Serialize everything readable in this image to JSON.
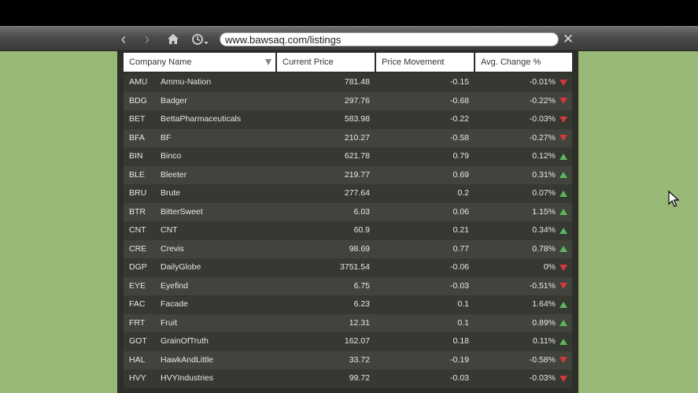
{
  "browser": {
    "url": "www.bawsaq.com/listings",
    "icons": {
      "back": "arrow-left-icon",
      "forward": "arrow-right-icon",
      "home": "home-icon",
      "history": "clock-icon",
      "close": "close-icon"
    }
  },
  "table": {
    "headers": [
      "Company Name",
      "Current Price",
      "Price Movement",
      "Avg. Change %"
    ],
    "rows": [
      {
        "symbol": "AMU",
        "name": "Ammu-Nation",
        "price": "781.48",
        "movement": "-0.15",
        "avg": "-0.01%",
        "trend": "down"
      },
      {
        "symbol": "BDG",
        "name": "Badger",
        "price": "297.76",
        "movement": "-0.68",
        "avg": "-0.22%",
        "trend": "down"
      },
      {
        "symbol": "BET",
        "name": "BettaPharmaceuticals",
        "price": "583.98",
        "movement": "-0.22",
        "avg": "-0.03%",
        "trend": "down"
      },
      {
        "symbol": "BFA",
        "name": "BF",
        "price": "210.27",
        "movement": "-0.58",
        "avg": "-0.27%",
        "trend": "down"
      },
      {
        "symbol": "BIN",
        "name": "Binco",
        "price": "621.78",
        "movement": "0.79",
        "avg": "0.12%",
        "trend": "up"
      },
      {
        "symbol": "BLE",
        "name": "Bleeter",
        "price": "219.77",
        "movement": "0.69",
        "avg": "0.31%",
        "trend": "up"
      },
      {
        "symbol": "BRU",
        "name": "Brute",
        "price": "277.64",
        "movement": "0.2",
        "avg": "0.07%",
        "trend": "up"
      },
      {
        "symbol": "BTR",
        "name": "BitterSweet",
        "price": "6.03",
        "movement": "0.06",
        "avg": "1.15%",
        "trend": "up"
      },
      {
        "symbol": "CNT",
        "name": "CNT",
        "price": "60.9",
        "movement": "0.21",
        "avg": "0.34%",
        "trend": "up"
      },
      {
        "symbol": "CRE",
        "name": "Crevis",
        "price": "98.69",
        "movement": "0.77",
        "avg": "0.78%",
        "trend": "up"
      },
      {
        "symbol": "DGP",
        "name": "DailyGlobe",
        "price": "3751.54",
        "movement": "-0.06",
        "avg": "0%",
        "trend": "down"
      },
      {
        "symbol": "EYE",
        "name": "Eyefind",
        "price": "6.75",
        "movement": "-0.03",
        "avg": "-0.51%",
        "trend": "down"
      },
      {
        "symbol": "FAC",
        "name": "Facade",
        "price": "6.23",
        "movement": "0.1",
        "avg": "1.64%",
        "trend": "up"
      },
      {
        "symbol": "FRT",
        "name": "Fruit",
        "price": "12.31",
        "movement": "0.1",
        "avg": "0.89%",
        "trend": "up"
      },
      {
        "symbol": "GOT",
        "name": "GrainOfTruth",
        "price": "162.07",
        "movement": "0.18",
        "avg": "0.11%",
        "trend": "up"
      },
      {
        "symbol": "HAL",
        "name": "HawkAndLittle",
        "price": "33.72",
        "movement": "-0.19",
        "avg": "-0.58%",
        "trend": "down"
      },
      {
        "symbol": "HVY",
        "name": "HVYIndustries",
        "price": "99.72",
        "movement": "-0.03",
        "avg": "-0.03%",
        "trend": "down"
      }
    ]
  },
  "colors": {
    "up": "#5cb65c",
    "down": "#d23a3a",
    "background": "#98b878"
  }
}
